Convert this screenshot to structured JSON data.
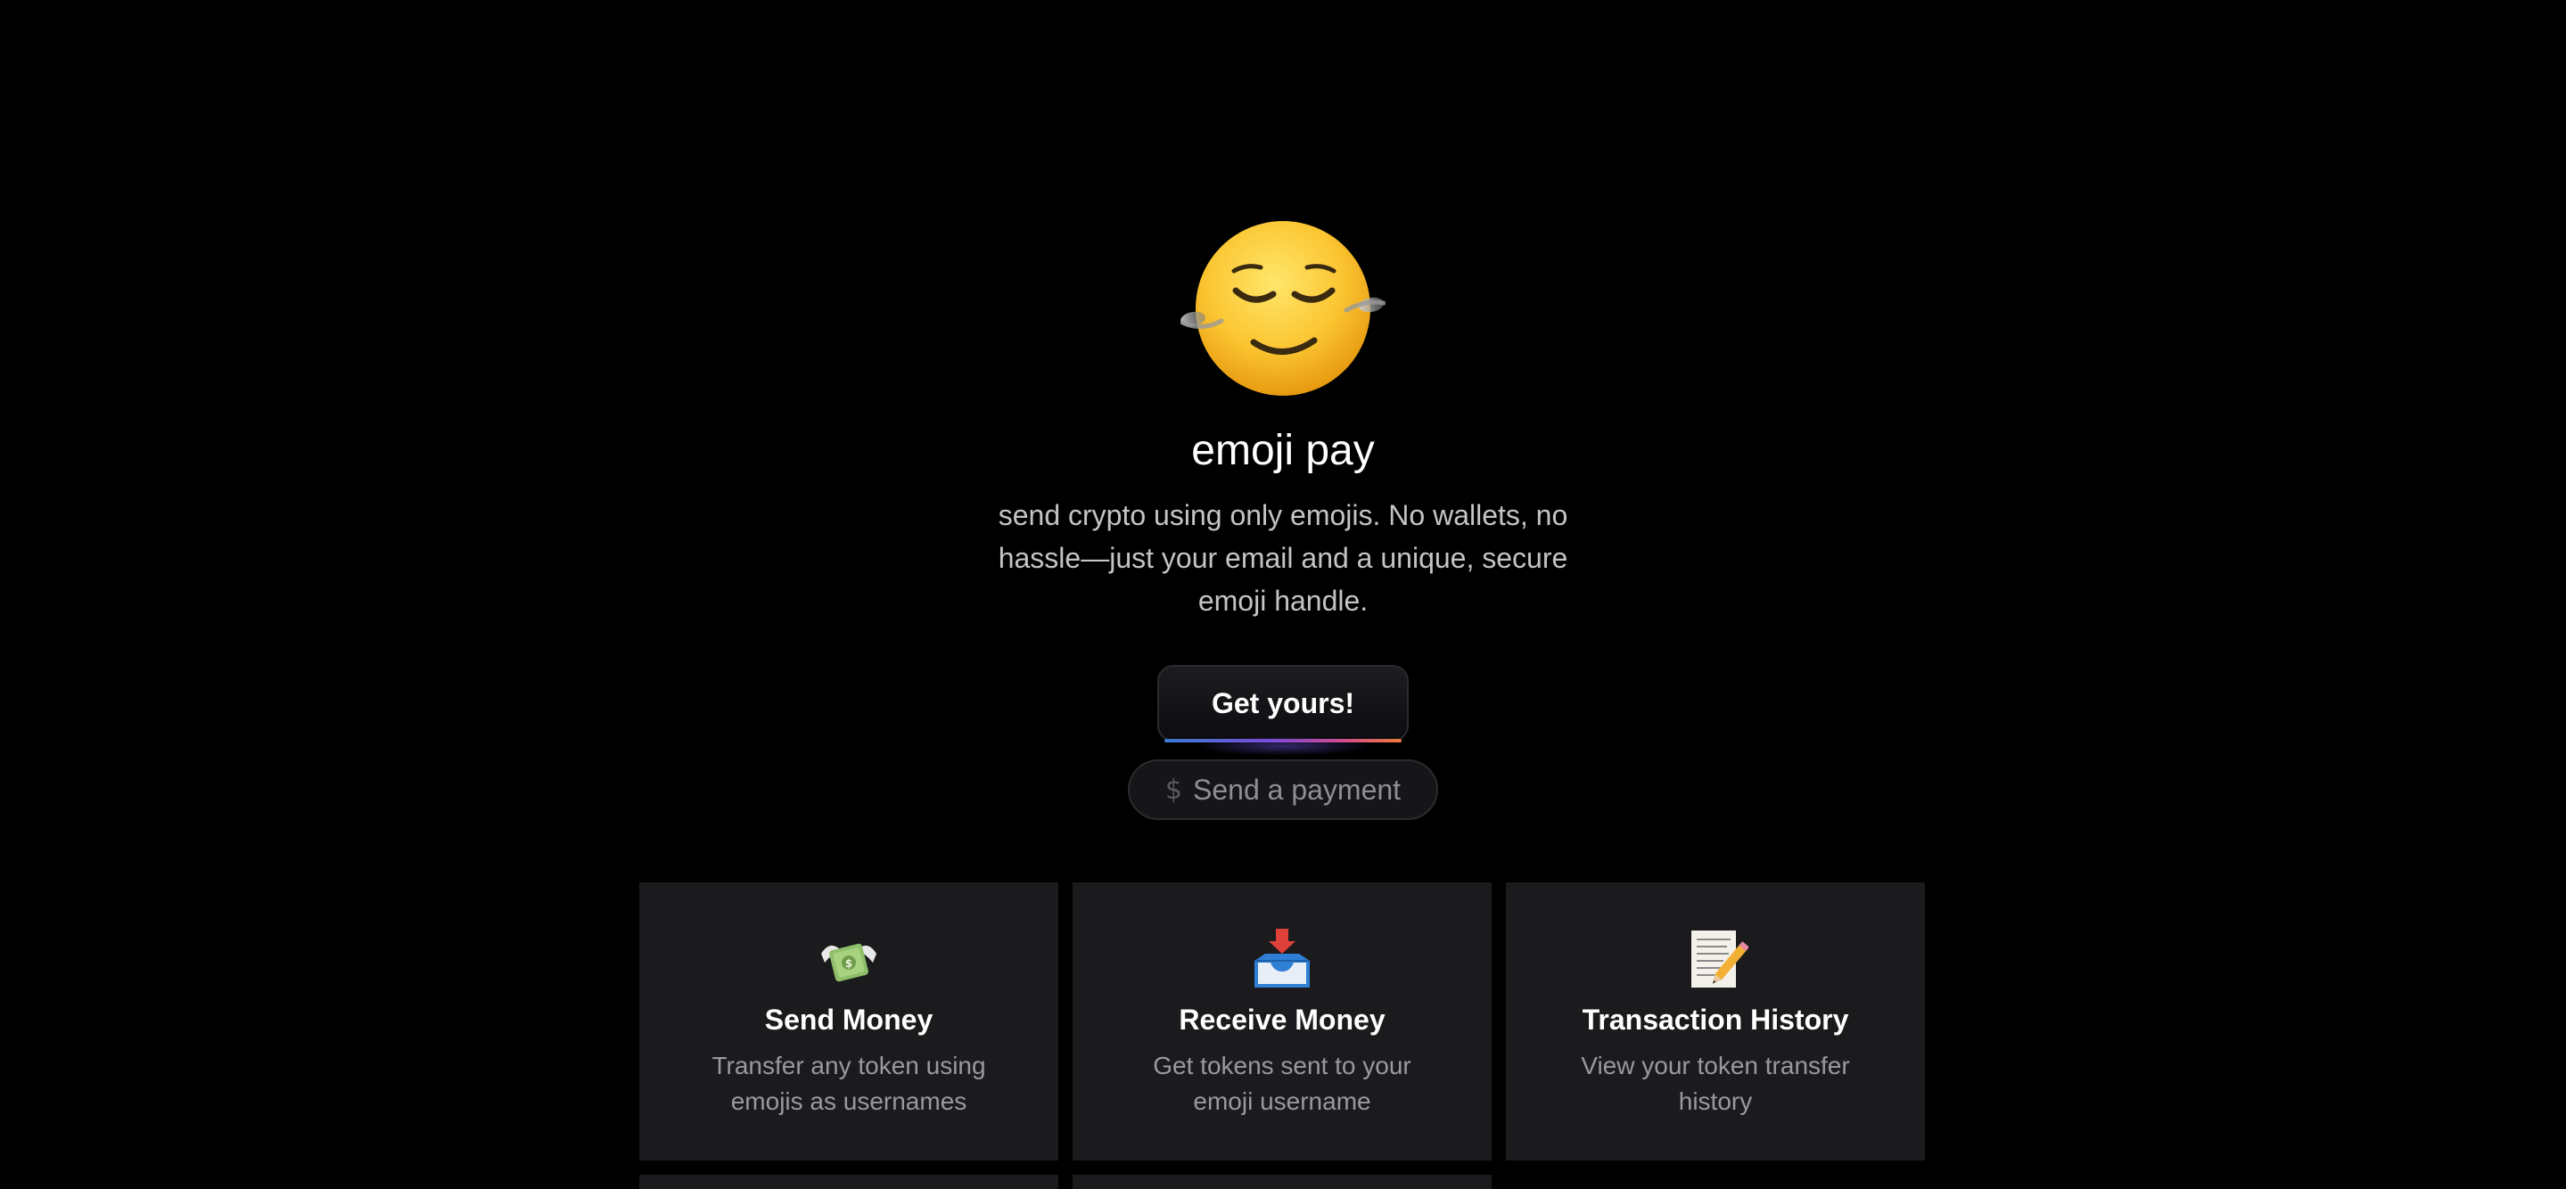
{
  "hero": {
    "icon": "relieved-face-emoji-icon",
    "title": "emoji pay",
    "description": "send crypto using only emojis. No wallets, no hassle—just your email and a unique, secure emoji handle."
  },
  "actions": {
    "get_yours_label": "Get yours!",
    "send_payment_label": "Send a payment",
    "send_payment_icon": "dollar-icon"
  },
  "features": [
    {
      "icon": "money-with-wings-icon",
      "title": "Send Money",
      "description": "Transfer any token using emojis as usernames"
    },
    {
      "icon": "inbox-tray-icon",
      "title": "Receive Money",
      "description": "Get tokens sent to your emoji username"
    },
    {
      "icon": "memo-icon",
      "title": "Transaction History",
      "description": "View your token transfer history"
    }
  ],
  "colors": {
    "background": "#000000",
    "card_background": "#1b1b1d",
    "text_primary": "#ffffff",
    "text_secondary": "#9a9a9e",
    "accent_gradient": [
      "#3a7bd5",
      "#7b4bd8",
      "#d04a8f",
      "#ef7a3a"
    ]
  }
}
